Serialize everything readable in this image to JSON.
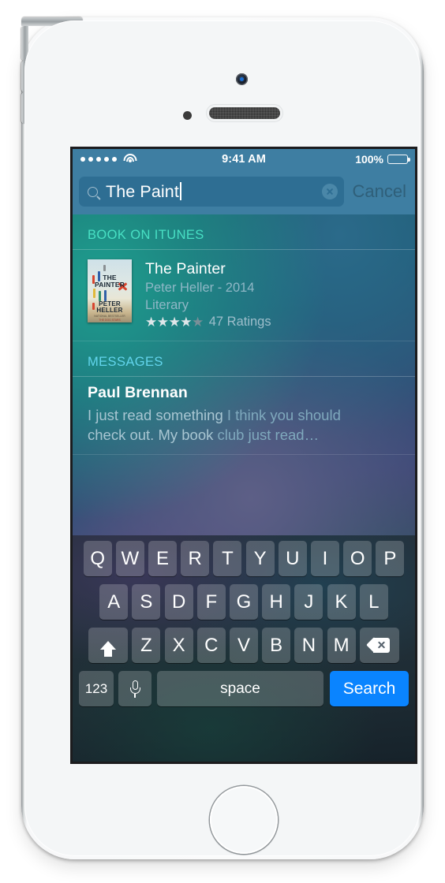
{
  "device": {
    "model_name": "iphone-5s-silver",
    "hardware": {
      "camera": "front-camera",
      "sensor": "proximity-sensor",
      "speaker": "earpiece-speaker",
      "home": "home-button",
      "buttons": [
        "power-button",
        "mute-switch",
        "volume-up-button",
        "volume-down-button"
      ]
    }
  },
  "status_bar": {
    "signal_dots": 5,
    "wifi": "wifi-icon",
    "time": "9:41 AM",
    "battery_percent": "100%",
    "battery_level": 100,
    "background_color": "#3e7ea2"
  },
  "search": {
    "query": "The Paint",
    "placeholder": "Search",
    "cancel_label": "Cancel",
    "search_icon": "search-icon",
    "clear_icon": "clear-icon",
    "field_color": "#2e6e93"
  },
  "results": {
    "sections": [
      {
        "id": "book",
        "header": "BOOK ON ITUNES",
        "header_color": "#48e0c4",
        "item": {
          "title": "The Painter",
          "author_year": "Peter Heller - 2014",
          "genre": "Literary",
          "stars_filled": 4,
          "stars_total": 5,
          "ratings_label": "47 Ratings",
          "cover_alt": "the-painter-book-cover"
        }
      },
      {
        "id": "messages",
        "header": "MESSAGES",
        "header_color": "#62d4ec",
        "item": {
          "sender": "Paul Brennan",
          "preview_part_1": "I just read something ",
          "preview_part_2": "I think you should",
          "preview_part_3": "check out. My book ",
          "preview_part_4": "club just read…"
        }
      }
    ]
  },
  "keyboard": {
    "row_1": [
      "Q",
      "W",
      "E",
      "R",
      "T",
      "Y",
      "U",
      "I",
      "O",
      "P"
    ],
    "row_2": [
      "A",
      "S",
      "D",
      "F",
      "G",
      "H",
      "J",
      "K",
      "L"
    ],
    "row_3": [
      "Z",
      "X",
      "C",
      "V",
      "B",
      "N",
      "M"
    ],
    "shift_icon": "shift-arrow-icon",
    "delete_icon": "delete-backspace-icon",
    "numbers_label": "123",
    "mic_icon": "microphone-icon",
    "space_label": "space",
    "search_label": "Search",
    "search_key_color": "#0a84ff"
  }
}
